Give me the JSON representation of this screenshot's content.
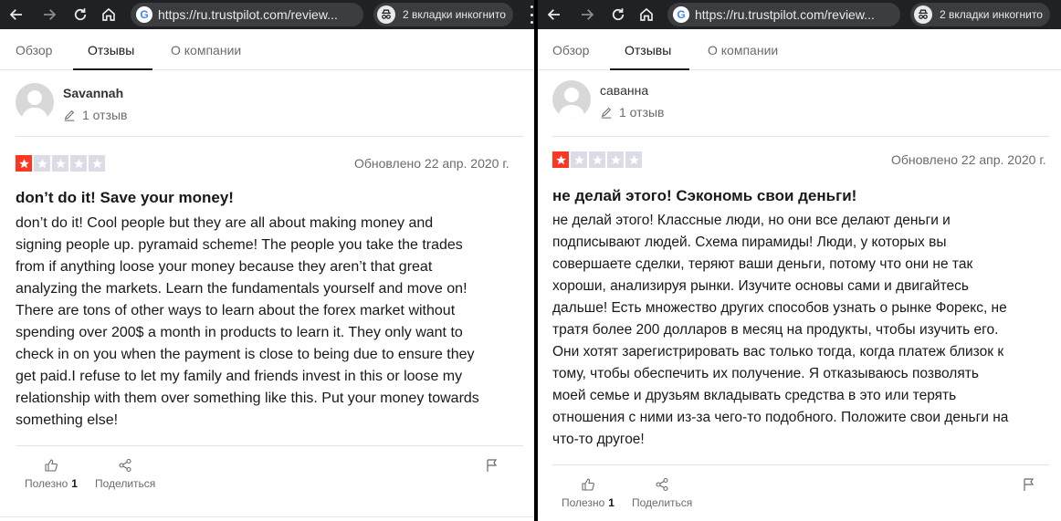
{
  "colors": {
    "toolbar_bg": "#202124",
    "star_filled": "#ff3722",
    "star_empty": "#dcdce6"
  },
  "panes": [
    {
      "lang": "en",
      "browser": {
        "url": "https://ru.trustpilot.com/review...",
        "incognito_label": "2 вкладки инкогнито",
        "icons": [
          "back-arrow-icon",
          "forward-arrow-icon",
          "reload-icon",
          "home-icon",
          "google-icon",
          "incognito-icon",
          "menu-dots-icon"
        ]
      },
      "tabs": [
        "Обзор",
        "Отзывы",
        "О компании"
      ],
      "active_tab": "Отзывы",
      "reviewer": {
        "name": "Savannah",
        "reviews_count": "1 отзыв"
      },
      "rating": {
        "stars": 1,
        "max": 5
      },
      "date": "Обновлено 22 апр. 2020 г.",
      "review_title": "don’t do it! Save your money!",
      "review_body": "don’t do it! Cool people but they are all about making money and\nsigning people up. pyramaid scheme! The people you take the trades\nfrom if anything loose your money because they aren’t that great\nanalyzing the markets. Learn the fundamentals yourself and move on!\nThere are tons of other ways to learn about the forex market without\nspending over 200$ a month in products to learn it. They only want to\ncheck in on you when the payment is close to being due to ensure they\nget paid.I refuse to let my family and friends invest in this or loose my\nrelationship with them over something like this. Put your money towards\nsomething else!",
      "actions": {
        "useful_label": "Полезно",
        "useful_count": "1",
        "share_label": "Поделиться"
      }
    },
    {
      "lang": "ru",
      "browser": {
        "url": "https://ru.trustpilot.com/review...",
        "incognito_label": "2 вкладки инкогнито",
        "icons": [
          "back-arrow-icon",
          "forward-arrow-icon",
          "reload-icon",
          "home-icon",
          "google-icon",
          "incognito-icon"
        ]
      },
      "tabs": [
        "Обзор",
        "Отзывы",
        "О компании"
      ],
      "active_tab": "Отзывы",
      "reviewer": {
        "name": "саванна",
        "reviews_count": "1 отзыв"
      },
      "rating": {
        "stars": 1,
        "max": 5
      },
      "date": "Обновлено 22 апр. 2020 г.",
      "review_title": "не делай этого! Сэкономь свои деньги!",
      "review_body": "не делай этого! Классные люди, но они все делают деньги и\nподписывают людей. Схема пирамиды! Люди, у которых вы\nсовершаете сделки, теряют ваши деньги, потому что они не так\nхороши, анализируя рынки. Изучите основы сами и двигайтесь\nдальше! Есть множество других способов узнать о рынке Форекс, не\nтратя более 200 долларов в месяц на продукты, чтобы изучить его.\nОни хотят зарегистрировать вас только тогда, когда платеж близок к\nтому, чтобы обеспечить их получение. Я отказываюсь позволять\nмоей семье и друзьям вкладывать средства в это или терять\nотношения с ними из-за чего-то подобного. Положите свои деньги на\nчто-то другое!",
      "actions": {
        "useful_label": "Полезно",
        "useful_count": "1",
        "share_label": "Поделиться"
      }
    }
  ]
}
